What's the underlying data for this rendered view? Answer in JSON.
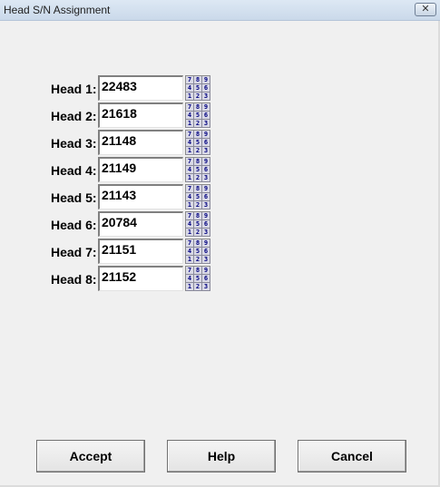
{
  "window": {
    "title": "Head S/N Assignment",
    "close_glyph": "✕"
  },
  "heads": [
    {
      "label": "Head 1:",
      "value": "22483"
    },
    {
      "label": "Head 2:",
      "value": "21618"
    },
    {
      "label": "Head 3:",
      "value": "21148"
    },
    {
      "label": "Head 4:",
      "value": "21149"
    },
    {
      "label": "Head 5:",
      "value": "21143"
    },
    {
      "label": "Head 6:",
      "value": "20784"
    },
    {
      "label": "Head 7:",
      "value": "21151"
    },
    {
      "label": "Head 8:",
      "value": "21152"
    }
  ],
  "keypad_keys": [
    "7",
    "8",
    "9",
    "4",
    "5",
    "6",
    "1",
    "2",
    "3"
  ],
  "buttons": {
    "accept": "Accept",
    "help": "Help",
    "cancel": "Cancel"
  }
}
